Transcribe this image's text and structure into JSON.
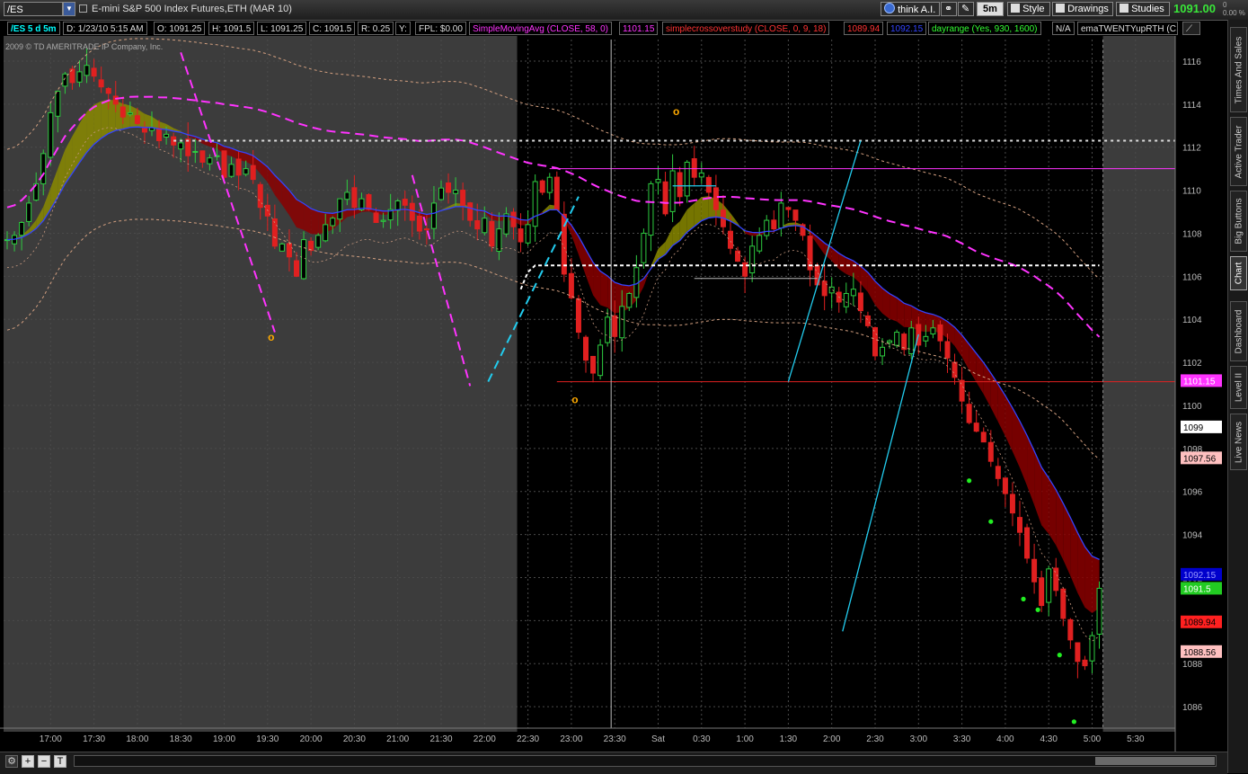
{
  "toolbar": {
    "symbol": "/ES",
    "description": "E-mini S&P 500 Index Futures,ETH (MAR 10)",
    "think_ai": "think A.I.",
    "interval": "5m",
    "style": "Style",
    "drawings": "Drawings",
    "studies": "Studies",
    "last_price": "1091.00",
    "change_top": "0",
    "change_pct": "0.00 %"
  },
  "info": {
    "chart_label": "/ES 5 d 5m",
    "date": "D: 1/23/10 5:15 AM",
    "open": "O: 1091.25",
    "high": "H: 1091.5",
    "low": "L: 1091.25",
    "close": "C: 1091.5",
    "range": "R: 0.25",
    "y": "Y:",
    "fpl": "FPL: $0.00",
    "sma_study": "SimpleMovingAvg (CLOSE, 58, 0)",
    "sma_value": "1101.15",
    "cross_study": "simplecrossoverstudy (CLOSE, 0, 9, 18)",
    "cross_value1": "1089.94",
    "cross_value2": "1092.15",
    "dayrange_study": "dayrange (Yes, 930, 1600)",
    "dayrange_value": "N/A",
    "ema_study": "emaTWENTYupRTH (C..."
  },
  "copyright": "2009 © TD AMERITRADE IP Company, Inc.",
  "sidebar": {
    "tabs": [
      "Times And Sales",
      "Active Trader",
      "Big Buttons",
      "Chart",
      "Dashboard",
      "Level II",
      "Live News"
    ],
    "active": "Chart"
  },
  "bottom": {
    "zoom_in": "+",
    "zoom_out": "−",
    "fit": "T"
  },
  "colors": {
    "up": "#2ecc40",
    "down": "#e02020",
    "sma": "#ff33ff",
    "ema_blue": "#3344ff",
    "ribbon_red": "#8b0000",
    "ribbon_yellow": "#8a8a00",
    "cyan": "#22ccee",
    "envelope": "#d4a080",
    "grid": "#555555",
    "last_price": "#22cc22"
  },
  "chart_data": {
    "type": "candlestick",
    "title": "",
    "ylim": [
      1085,
      1117
    ],
    "y_ticks": [
      1086,
      1088,
      1090,
      1092,
      1094,
      1096,
      1098,
      1100,
      1102,
      1104,
      1106,
      1108,
      1110,
      1112,
      1114,
      1116
    ],
    "x_ticks": [
      "17:00",
      "17:30",
      "18:00",
      "18:30",
      "19:00",
      "19:30",
      "20:00",
      "20:30",
      "21:00",
      "21:30",
      "22:00",
      "22:30",
      "23:00",
      "23:30",
      "Sat",
      "0:30",
      "1:00",
      "1:30",
      "2:00",
      "2:30",
      "3:00",
      "3:30",
      "4:00",
      "4:30",
      "5:00",
      "5:30"
    ],
    "x_tick_slots": [
      6,
      12,
      18,
      24,
      30,
      36,
      42,
      48,
      54,
      60,
      66,
      72,
      78,
      84,
      90,
      96,
      102,
      108,
      114,
      120,
      126,
      132,
      138,
      144,
      150,
      156
    ],
    "session_start_slot": 70.5,
    "session_end_slot": 151.5,
    "total_slots": 160,
    "grid": true,
    "close_path": [
      [
        0,
        1107.7
      ],
      [
        1,
        1107.9
      ],
      [
        2,
        1108.5
      ],
      [
        3,
        1109.4
      ],
      [
        4,
        1110.3
      ],
      [
        5,
        1111.7
      ],
      [
        6,
        1113.6
      ],
      [
        7,
        1114.6
      ],
      [
        8,
        1115.4
      ],
      [
        9,
        1115.0
      ],
      [
        10,
        1115.5
      ],
      [
        11,
        1115.8
      ],
      [
        12,
        1115.3
      ],
      [
        13,
        1114.8
      ],
      [
        14,
        1114.5
      ],
      [
        15,
        1114.0
      ],
      [
        16,
        1113.4
      ],
      [
        17,
        1113.6
      ],
      [
        18,
        1113.1
      ],
      [
        19,
        1112.7
      ],
      [
        20,
        1112.9
      ],
      [
        21,
        1112.3
      ],
      [
        22,
        1112.6
      ],
      [
        23,
        1112.1
      ],
      [
        24,
        1112.2
      ],
      [
        25,
        1111.6
      ],
      [
        26,
        1111.8
      ],
      [
        27,
        1111.3
      ],
      [
        28,
        1111.5
      ],
      [
        29,
        1111.6
      ],
      [
        30,
        1110.6
      ],
      [
        31,
        1111.2
      ],
      [
        32,
        1110.7
      ],
      [
        33,
        1111.0
      ],
      [
        34,
        1110.5
      ],
      [
        35,
        1109.2
      ],
      [
        36,
        1108.8
      ],
      [
        37,
        1107.4
      ],
      [
        38,
        1107.5
      ],
      [
        39,
        1106.9
      ],
      [
        40,
        1106.0
      ],
      [
        41,
        1107.7
      ],
      [
        42,
        1107.2
      ],
      [
        43,
        1107.9
      ],
      [
        44,
        1108.4
      ],
      [
        45,
        1108.7
      ],
      [
        46,
        1109.6
      ],
      [
        47,
        1109.9
      ],
      [
        48,
        1109.2
      ],
      [
        49,
        1109.6
      ],
      [
        50,
        1109.1
      ],
      [
        51,
        1108.5
      ],
      [
        52,
        1108.6
      ],
      [
        53,
        1109.1
      ],
      [
        54,
        1109.5
      ],
      [
        55,
        1109.3
      ],
      [
        56,
        1108.6
      ],
      [
        57,
        1108.1
      ],
      [
        58,
        1108.2
      ],
      [
        59,
        1109.4
      ],
      [
        60,
        1110.1
      ],
      [
        61,
        1109.9
      ],
      [
        62,
        1110.0
      ],
      [
        63,
        1109.3
      ],
      [
        64,
        1108.6
      ],
      [
        65,
        1108.2
      ],
      [
        66,
        1108.7
      ],
      [
        67,
        1107.4
      ],
      [
        68,
        1108.2
      ],
      [
        69,
        1108.9
      ],
      [
        70,
        1108.3
      ],
      [
        71,
        1107.6
      ],
      [
        72,
        1108.4
      ],
      [
        73,
        1110.4
      ],
      [
        74,
        1109.9
      ],
      [
        75,
        1110.6
      ],
      [
        76,
        1109.1
      ],
      [
        77,
        1106.1
      ],
      [
        78,
        1105.0
      ],
      [
        79,
        1103.4
      ],
      [
        80,
        1102.1
      ],
      [
        81,
        1101.5
      ],
      [
        82,
        1102.8
      ],
      [
        83,
        1104.1
      ],
      [
        84,
        1103.2
      ],
      [
        85,
        1104.6
      ],
      [
        86,
        1105.2
      ],
      [
        87,
        1106.4
      ],
      [
        88,
        1108.0
      ],
      [
        89,
        1110.3
      ],
      [
        90,
        1110.5
      ],
      [
        91,
        1108.9
      ],
      [
        92,
        1110.9
      ],
      [
        93,
        1109.7
      ],
      [
        94,
        1111.3
      ],
      [
        95,
        1110.6
      ],
      [
        96,
        1110.8
      ],
      [
        97,
        1109.9
      ],
      [
        98,
        1109.1
      ],
      [
        99,
        1108.3
      ],
      [
        100,
        1107.3
      ],
      [
        101,
        1106.7
      ],
      [
        102,
        1106.0
      ],
      [
        103,
        1107.4
      ],
      [
        104,
        1107.9
      ],
      [
        105,
        1108.6
      ],
      [
        106,
        1108.2
      ],
      [
        107,
        1109.4
      ],
      [
        108,
        1109.1
      ],
      [
        109,
        1108.6
      ],
      [
        110,
        1107.9
      ],
      [
        111,
        1106.3
      ],
      [
        112,
        1105.6
      ],
      [
        113,
        1105.1
      ],
      [
        114,
        1105.5
      ],
      [
        115,
        1104.8
      ],
      [
        116,
        1105.2
      ],
      [
        117,
        1105.4
      ],
      [
        118,
        1104.4
      ],
      [
        119,
        1103.7
      ],
      [
        120,
        1102.3
      ],
      [
        121,
        1102.7
      ],
      [
        122,
        1103.0
      ],
      [
        123,
        1103.4
      ],
      [
        124,
        1102.6
      ],
      [
        125,
        1103.6
      ],
      [
        126,
        1102.8
      ],
      [
        127,
        1103.2
      ],
      [
        128,
        1103.6
      ],
      [
        129,
        1103.0
      ],
      [
        130,
        1102.2
      ],
      [
        131,
        1101.3
      ],
      [
        132,
        1100.2
      ],
      [
        133,
        1099.2
      ],
      [
        134,
        1098.8
      ],
      [
        135,
        1098.3
      ],
      [
        136,
        1097.4
      ],
      [
        137,
        1096.6
      ],
      [
        138,
        1095.9
      ],
      [
        139,
        1095.0
      ],
      [
        140,
        1094.1
      ],
      [
        141,
        1092.9
      ],
      [
        142,
        1091.8
      ],
      [
        143,
        1090.7
      ],
      [
        144,
        1092.4
      ],
      [
        145,
        1091.4
      ],
      [
        146,
        1090.1
      ],
      [
        147,
        1089.1
      ],
      [
        148,
        1088.1
      ],
      [
        149,
        1087.9
      ],
      [
        150,
        1089.3
      ],
      [
        151,
        1091.5
      ]
    ],
    "series": [
      {
        "name": "SimpleMovingAvg (CLOSE, 58, 0)",
        "last": 1101.15
      },
      {
        "name": "simplecrossoverstudy (CLOSE, 0, 9, 18)",
        "last": [
          1089.94,
          1092.15
        ]
      },
      {
        "name": "emaTWENTYupRTH",
        "last": 1097.56
      }
    ],
    "price_labels": [
      {
        "value": 1101.15,
        "text": "1101.15",
        "bg": "#ff33ff",
        "fg": "#ffffff"
      },
      {
        "value": 1099,
        "text": "1099",
        "bg": "#ffffff",
        "fg": "#000000"
      },
      {
        "value": 1097.56,
        "text": "1097.56",
        "bg": "#ffc0c0",
        "fg": "#000000"
      },
      {
        "value": 1092.15,
        "text": "1092.15",
        "bg": "#0000cc",
        "fg": "#9999ff"
      },
      {
        "value": 1091.5,
        "text": "1091.5",
        "bg": "#22cc22",
        "fg": "#ffffff"
      },
      {
        "value": 1089.94,
        "text": "1089.94",
        "bg": "#ff2020",
        "fg": "#000000"
      },
      {
        "value": 1088.56,
        "text": "1088.56",
        "bg": "#ffc0c0",
        "fg": "#000000"
      }
    ],
    "markers": [
      {
        "slot": 36.5,
        "value": 1103.0,
        "text": "o"
      },
      {
        "slot": 92.5,
        "value": 1113.5,
        "text": "o"
      },
      {
        "slot": 78.5,
        "value": 1100.1,
        "text": "o"
      }
    ],
    "green_dots": [
      [
        133,
        1096.5
      ],
      [
        136,
        1094.6
      ],
      [
        140.5,
        1091.0
      ],
      [
        142.5,
        1090.5
      ],
      [
        145.5,
        1088.4
      ],
      [
        147.5,
        1085.3
      ]
    ]
  }
}
